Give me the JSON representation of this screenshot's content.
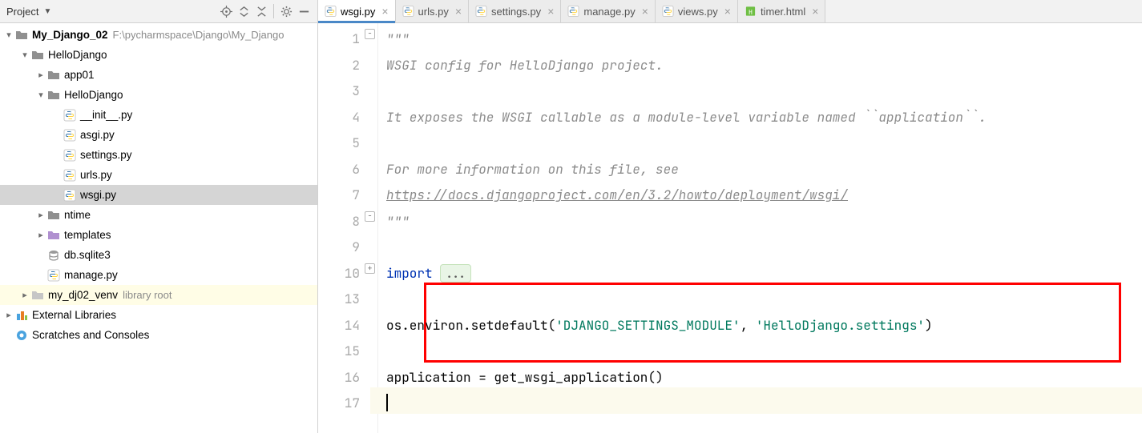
{
  "sidebar": {
    "title": "Project",
    "tree": [
      {
        "label": "My_Django_02",
        "bold": true,
        "hint": "F:\\pycharmspace\\Django\\My_Django",
        "icon": "folder",
        "arrow": "open",
        "indent": 0
      },
      {
        "label": "HelloDjango",
        "icon": "folder",
        "arrow": "open",
        "indent": 1
      },
      {
        "label": "app01",
        "icon": "folder",
        "arrow": "closed",
        "indent": 2
      },
      {
        "label": "HelloDjango",
        "icon": "folder",
        "arrow": "open",
        "indent": 2
      },
      {
        "label": "__init__.py",
        "icon": "py",
        "arrow": "none",
        "indent": 3
      },
      {
        "label": "asgi.py",
        "icon": "py",
        "arrow": "none",
        "indent": 3
      },
      {
        "label": "settings.py",
        "icon": "py",
        "arrow": "none",
        "indent": 3
      },
      {
        "label": "urls.py",
        "icon": "py",
        "arrow": "none",
        "indent": 3
      },
      {
        "label": "wsgi.py",
        "icon": "py",
        "arrow": "none",
        "indent": 3,
        "selected": true
      },
      {
        "label": "ntime",
        "icon": "folder",
        "arrow": "closed",
        "indent": 2
      },
      {
        "label": "templates",
        "icon": "templates",
        "arrow": "closed",
        "indent": 2
      },
      {
        "label": "db.sqlite3",
        "icon": "db",
        "arrow": "none",
        "indent": 2
      },
      {
        "label": "manage.py",
        "icon": "py",
        "arrow": "none",
        "indent": 2
      },
      {
        "label": "my_dj02_venv",
        "hint": "library root",
        "icon": "venv",
        "arrow": "closed",
        "indent": 1,
        "libroot": true
      },
      {
        "label": "External Libraries",
        "icon": "ext",
        "arrow": "closed",
        "indent": 0
      },
      {
        "label": "Scratches and Consoles",
        "icon": "scratch",
        "arrow": "none",
        "indent": 0
      }
    ]
  },
  "tabs": [
    {
      "label": "wsgi.py",
      "icon": "py",
      "active": true
    },
    {
      "label": "urls.py",
      "icon": "py"
    },
    {
      "label": "settings.py",
      "icon": "py"
    },
    {
      "label": "manage.py",
      "icon": "py"
    },
    {
      "label": "views.py",
      "icon": "py"
    },
    {
      "label": "timer.html",
      "icon": "html"
    }
  ],
  "code": {
    "line_numbers": [
      "1",
      "2",
      "3",
      "4",
      "5",
      "6",
      "7",
      "8",
      "9",
      "10",
      "13",
      "14",
      "15",
      "16",
      "17"
    ],
    "l1": "\"\"\"",
    "l2": "WSGI config for HelloDjango project.",
    "l4a": "It exposes the WSGI callable as a module-level variable named ``application``.",
    "l6": "For more information on this file, see",
    "l7": "https://docs.djangoproject.com/en/3.2/howto/deployment/wsgi/",
    "l8": "\"\"\"",
    "l10_kw": "import",
    "l10_fold": "...",
    "l14_pre": "os.environ.setdefault(",
    "l14_s1": "'DJANGO_SETTINGS_MODULE'",
    "l14_mid": ", ",
    "l14_s2": "'HelloDjango.settings'",
    "l14_post": ")",
    "l16": "application = get_wsgi_application()"
  }
}
